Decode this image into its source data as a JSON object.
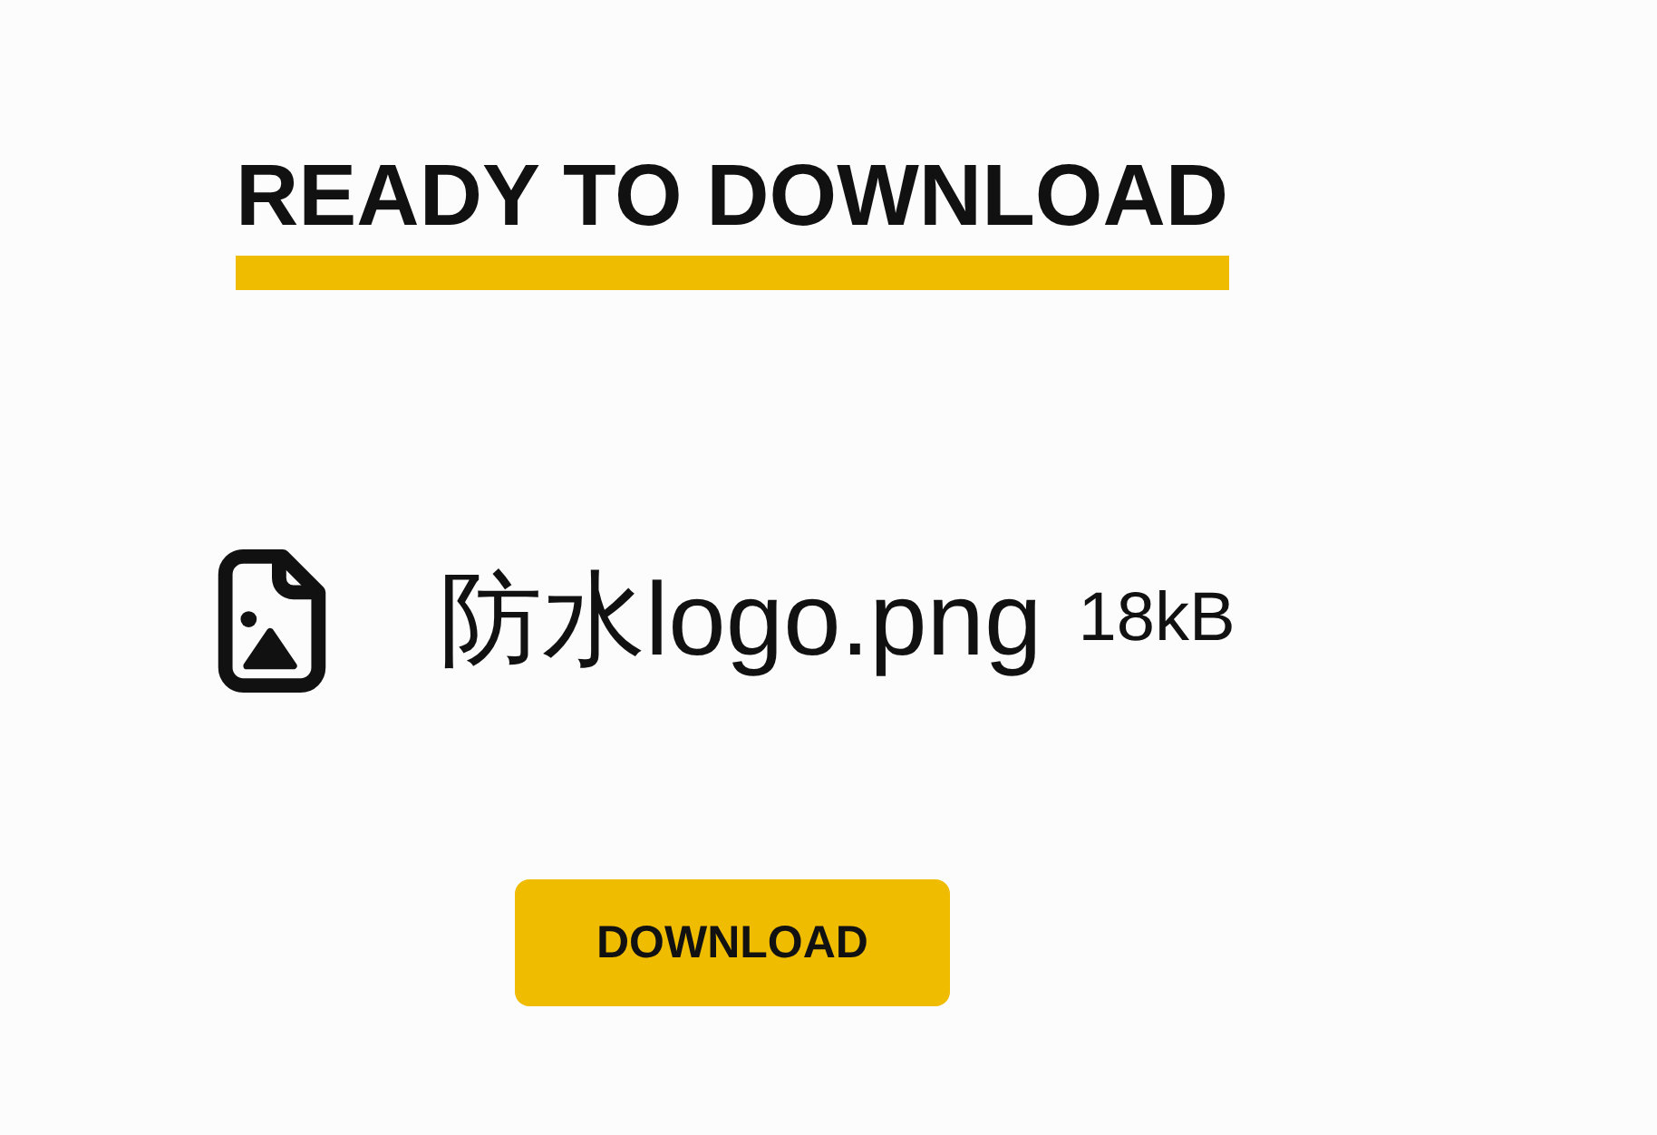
{
  "heading": "READY TO DOWNLOAD",
  "file": {
    "name": "防水logo.png",
    "size": "18kB"
  },
  "download_button": {
    "label": "DOWNLOAD"
  }
}
